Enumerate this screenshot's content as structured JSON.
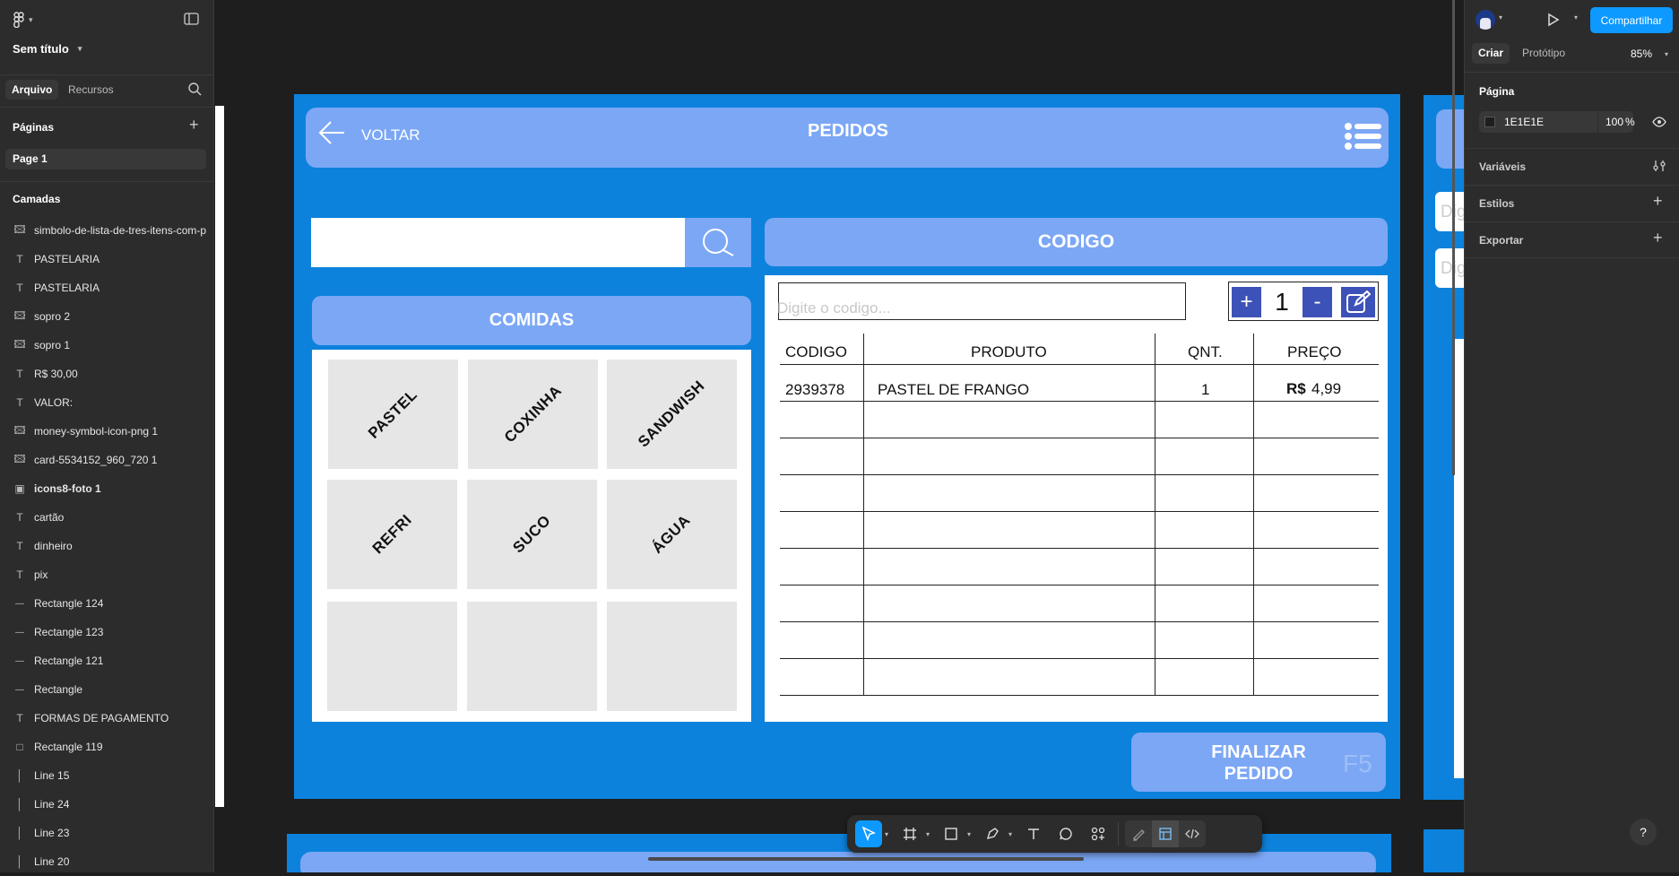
{
  "left_panel": {
    "file_name": "Sem título",
    "tabs": [
      "Arquivo",
      "Recursos"
    ],
    "pages_title": "Páginas",
    "pages": [
      "Page 1"
    ],
    "layers_title": "Camadas",
    "layers": [
      {
        "icon": "image",
        "name": "simbolo-de-lista-de-tres-itens-com-p"
      },
      {
        "icon": "text",
        "name": "PASTELARIA"
      },
      {
        "icon": "text",
        "name": "PASTELARIA"
      },
      {
        "icon": "image",
        "name": "sopro 2"
      },
      {
        "icon": "image",
        "name": "sopro 1"
      },
      {
        "icon": "text",
        "name": "R$ 30,00"
      },
      {
        "icon": "text",
        "name": "VALOR:"
      },
      {
        "icon": "image",
        "name": "money-symbol-icon-png 1"
      },
      {
        "icon": "image",
        "name": "card-5534152_960_720 1"
      },
      {
        "icon": "frame",
        "name": "icons8-foto 1"
      },
      {
        "icon": "text",
        "name": "cartão"
      },
      {
        "icon": "text",
        "name": "dinheiro"
      },
      {
        "icon": "text",
        "name": "pix"
      },
      {
        "icon": "line",
        "name": "Rectangle 124"
      },
      {
        "icon": "line",
        "name": "Rectangle 123"
      },
      {
        "icon": "line",
        "name": "Rectangle 121"
      },
      {
        "icon": "line",
        "name": "Rectangle"
      },
      {
        "icon": "text",
        "name": "FORMAS DE PAGAMENTO"
      },
      {
        "icon": "rect",
        "name": "Rectangle 119"
      },
      {
        "icon": "vline",
        "name": "Line 15"
      },
      {
        "icon": "vline",
        "name": "Line 24"
      },
      {
        "icon": "vline",
        "name": "Line 23"
      },
      {
        "icon": "vline",
        "name": "Line 20"
      }
    ]
  },
  "right_panel": {
    "share_label": "Compartilhar",
    "tabs": [
      "Criar",
      "Protótipo"
    ],
    "zoom": "85%",
    "page_title": "Página",
    "page_color": "1E1E1E",
    "page_opacity": "100",
    "percent_sign": "%",
    "sections": [
      "Variáveis",
      "Estilos",
      "Exportar"
    ],
    "help": "?"
  },
  "design": {
    "back_label": "VOLTAR",
    "title": "PEDIDOS",
    "code_header": "CODIGO",
    "foods_header": "COMIDAS",
    "code_placeholder": "Digite o codigo...",
    "quantity": "1",
    "plus": "+",
    "minus": "-",
    "foods": [
      "PASTEL",
      "COXINHA",
      "SANDWISH",
      "REFRI",
      "SUCO",
      "ÁGUA"
    ],
    "table_headers": [
      "CODIGO",
      "PRODUTO",
      "QNT.",
      "PREÇO"
    ],
    "rows": [
      {
        "code": "2939378",
        "product": "PASTEL DE FRANGO",
        "qty": "1",
        "price_cur": "R$",
        "price": "4,99"
      }
    ],
    "finish_line1": "FINALIZAR",
    "finish_line2": "PEDIDO",
    "shortcut": "F5",
    "side_peek": [
      "Dig",
      "Dig"
    ]
  },
  "colors": {
    "accent": "#0d99ff",
    "frame_blue": "#0c82dc",
    "header_blue": "#7ca7f5",
    "tile_gray": "#e6e6e6"
  }
}
